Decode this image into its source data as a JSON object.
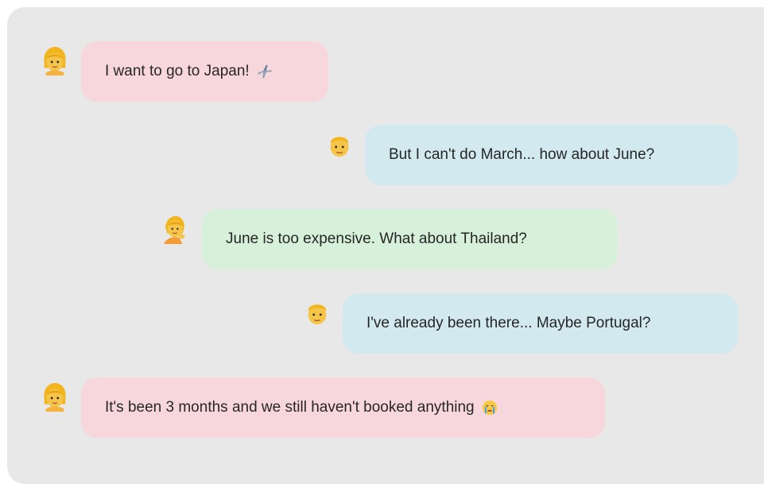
{
  "messages": [
    {
      "speaker": "woman",
      "avatar_icon": "woman-blonde-icon",
      "text": "I want to go to Japan!",
      "trailing_icon": "airplane-icon",
      "color": "#f8d7dc"
    },
    {
      "speaker": "man",
      "avatar_icon": "man-blonde-icon",
      "text": "But I can't do March... how about June?",
      "color": "#d2e9ef"
    },
    {
      "speaker": "woman2",
      "avatar_icon": "woman-tipping-hand-icon",
      "text": "June is too expensive. What about Thailand?",
      "color": "#d6f0da"
    },
    {
      "speaker": "man",
      "avatar_icon": "man-blonde-icon",
      "text": "I've already been there... Maybe Portugal?",
      "color": "#d2e9ef"
    },
    {
      "speaker": "woman",
      "avatar_icon": "woman-blonde-icon",
      "text": "It's been 3 months and we still haven't booked anything",
      "trailing_icon": "crying-face-icon",
      "color": "#f8d7dc"
    }
  ],
  "colors": {
    "panel_background": "#e8e8e8",
    "pink_bubble": "#f8d7dc",
    "blue_bubble": "#d2e9ef",
    "green_bubble": "#d6f0da"
  }
}
